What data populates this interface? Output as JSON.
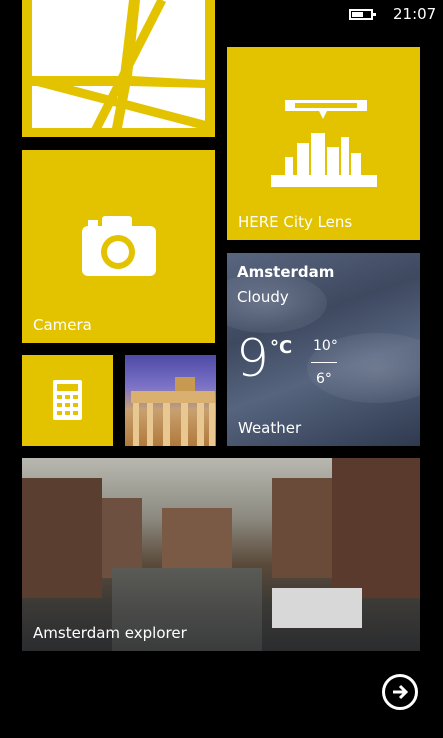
{
  "status": {
    "time": "21:07",
    "battery_icon": "battery-icon"
  },
  "tiles": {
    "city_lens": {
      "label": "HERE City Lens"
    },
    "camera": {
      "label": "Camera"
    },
    "weather": {
      "city": "Amsterdam",
      "condition": "Cloudy",
      "temperature": "9",
      "unit": "°C",
      "high": "10°",
      "low": "6°",
      "label": "Weather"
    },
    "explorer": {
      "label": "Amsterdam explorer"
    }
  },
  "accent_color": "#e3c300",
  "icons": [
    "windows-logo-icon",
    "city-lens-icon",
    "camera-icon",
    "calculator-icon",
    "arrow-right-icon"
  ]
}
